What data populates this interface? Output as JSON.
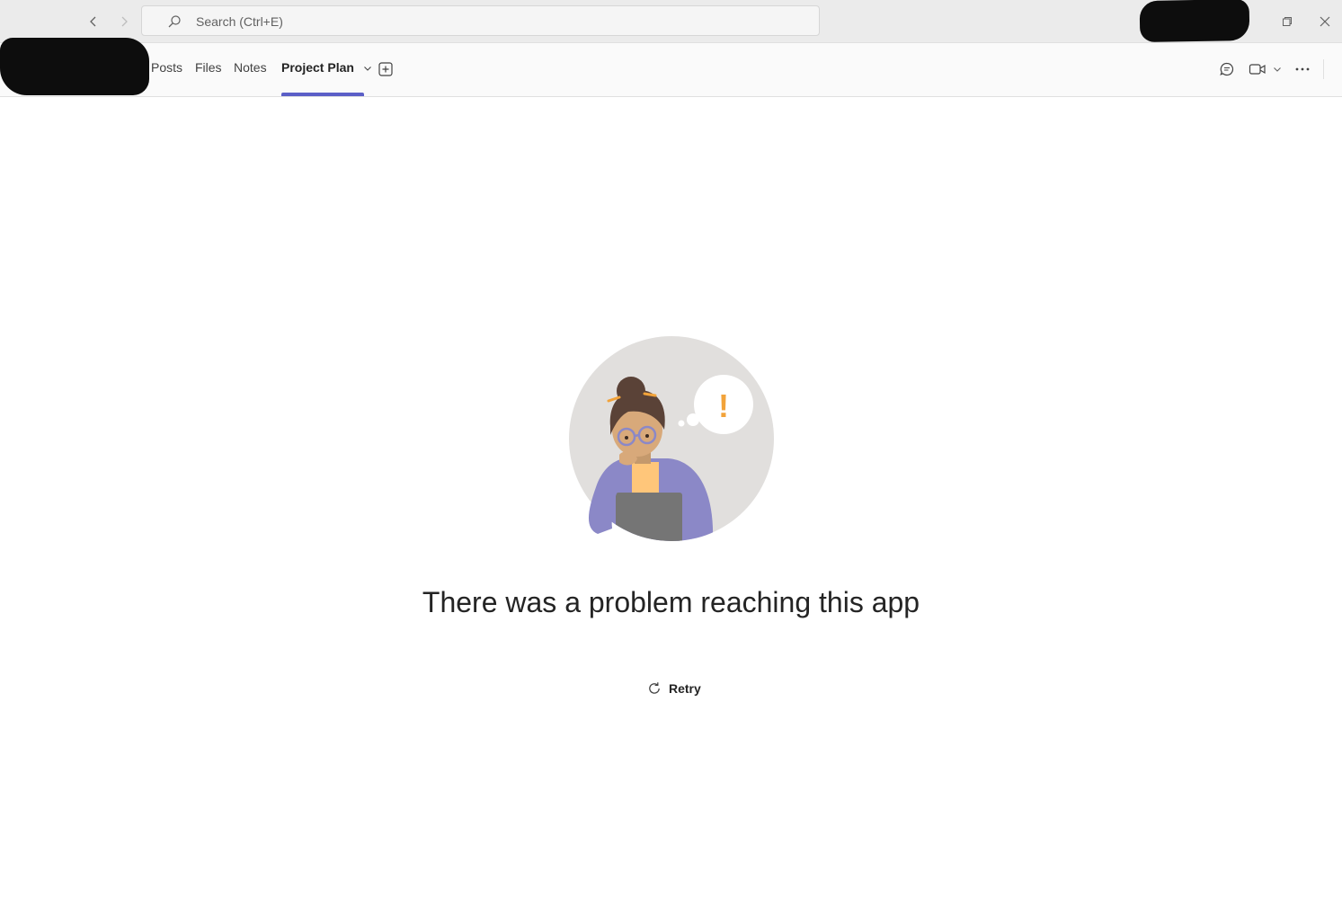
{
  "titlebar": {
    "search_placeholder": "Search (Ctrl+E)"
  },
  "tabs": [
    {
      "label": "Posts"
    },
    {
      "label": "Files"
    },
    {
      "label": "Notes"
    },
    {
      "label": "Project Plan",
      "active": true
    }
  ],
  "main": {
    "error_title": "There was a problem reaching this app",
    "retry_label": "Retry",
    "alert_glyph": "!"
  },
  "colors": {
    "accent": "#5b5fc7",
    "titlebar_bg": "#ebebeb",
    "tabbar_bg": "#fafafa",
    "illustration_bg": "#e1dfdd",
    "alert": "#f2a33a"
  },
  "icons": {
    "back": "chevron-left-icon",
    "forward": "chevron-right-icon",
    "search": "search-icon",
    "restore": "restore-window-icon",
    "close": "close-icon",
    "add_tab": "add-tab-icon",
    "chat": "chat-icon",
    "video": "video-camera-icon",
    "more": "more-options-icon",
    "retry": "refresh-icon"
  }
}
